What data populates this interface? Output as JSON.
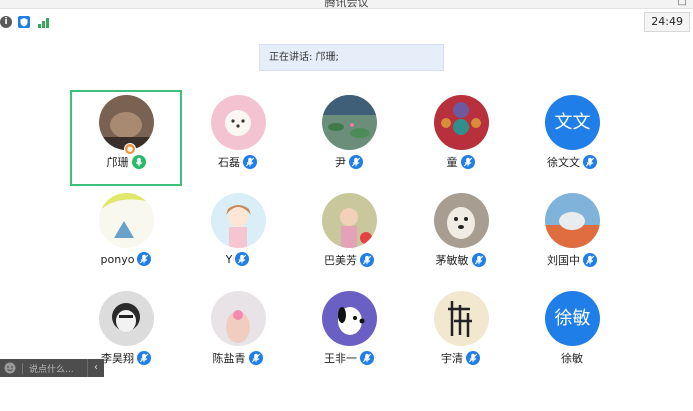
{
  "window": {
    "title": "腾讯会议"
  },
  "toolbar": {
    "timer": "24:49"
  },
  "speaking": {
    "text": "正在讲话: 邝珊;"
  },
  "participants": [
    {
      "name": "邝珊",
      "mic": "speaking",
      "avatar": "photo-cat",
      "selected": true,
      "host": true
    },
    {
      "name": "石磊",
      "mic": "muted",
      "avatar": "photo-puppy-pink"
    },
    {
      "name": "尹",
      "mic": "muted",
      "avatar": "photo-lilypads"
    },
    {
      "name": "童",
      "mic": "muted",
      "avatar": "photo-mosaic"
    },
    {
      "name": "徐文文",
      "mic": "muted",
      "avatar": "text",
      "avatar_text": "文文"
    },
    {
      "name": "ponyo",
      "mic": "muted",
      "avatar": "photo-drawing"
    },
    {
      "name": "Y",
      "mic": "muted",
      "avatar": "photo-anime-girl"
    },
    {
      "name": "巴美芳",
      "mic": "muted",
      "avatar": "photo-child"
    },
    {
      "name": "茅敏敏",
      "mic": "muted",
      "avatar": "photo-dog"
    },
    {
      "name": "刘国中",
      "mic": "muted",
      "avatar": "photo-sea-rock"
    },
    {
      "name": "李昊翔",
      "mic": "muted",
      "avatar": "photo-bw-face"
    },
    {
      "name": "陈盐青",
      "mic": "muted",
      "avatar": "photo-flower-hand"
    },
    {
      "name": "王非一",
      "mic": "muted",
      "avatar": "photo-snoopy"
    },
    {
      "name": "宇清",
      "mic": "muted",
      "avatar": "photo-calligraphy"
    },
    {
      "name": "徐敏",
      "mic": "none",
      "avatar": "text",
      "avatar_text": "徐敏"
    }
  ],
  "chat": {
    "placeholder": "说点什么..."
  },
  "colors": {
    "accent": "#1f7ee8",
    "selected_border": "#3cc07a",
    "speaking_mic": "#2bb86b"
  }
}
